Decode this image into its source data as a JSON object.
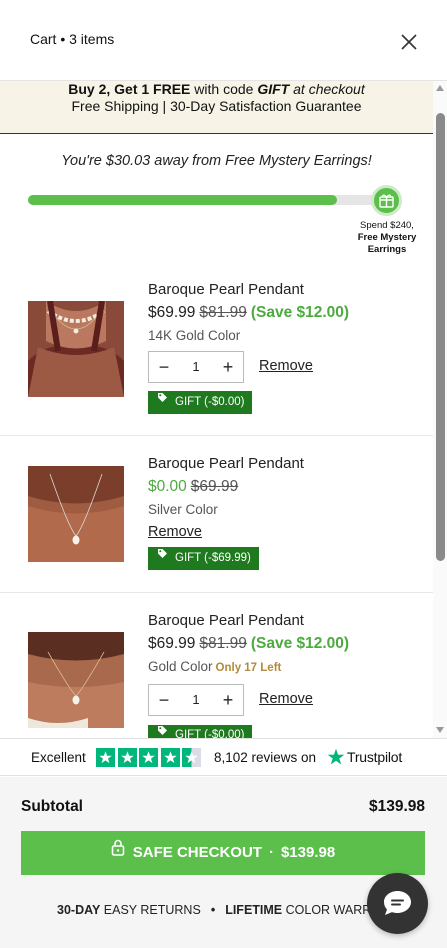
{
  "header": {
    "title": "Cart • 3 items"
  },
  "promo": {
    "line1_bold": "Buy 2, Get 1 FREE",
    "line1_mid": " with code ",
    "line1_code": "GIFT",
    "line1_end": " at checkout",
    "line2": "Free Shipping | 30-Day Satisfaction Guarantee"
  },
  "progress": {
    "message": "You're $30.03 away from Free Mystery Earrings!",
    "fraction": 0.87,
    "goal_line1": "Spend $240,",
    "goal_line2": "Free Mystery Earrings"
  },
  "items": [
    {
      "name": "Baroque Pearl Pendant",
      "price": "$69.99",
      "compare_price": "$81.99",
      "save": "(Save $12.00)",
      "variant": "14K Gold Color",
      "low_stock": "",
      "quantity": "1",
      "remove": "Remove",
      "gift": "GIFT (-$0.00)"
    },
    {
      "name": "Baroque Pearl Pendant",
      "price": "$0.00",
      "compare_price": "$69.99",
      "save": "",
      "variant": "Silver Color",
      "low_stock": "",
      "quantity": "",
      "remove": "Remove",
      "gift": "GIFT (-$69.99)"
    },
    {
      "name": "Baroque Pearl Pendant",
      "price": "$69.99",
      "compare_price": "$81.99",
      "save": "(Save $12.00)",
      "variant": "Gold Color",
      "low_stock": "Only 17 Left",
      "quantity": "1",
      "remove": "Remove",
      "gift": "GIFT (-$0.00)"
    }
  ],
  "trust": {
    "rating_word": "Excellent",
    "rating_stars": 4.5,
    "reviews": "8,102 reviews on",
    "brand": "Trustpilot"
  },
  "footer": {
    "subtotal_label": "Subtotal",
    "subtotal_value": "$139.98",
    "checkout_label": "SAFE CHECKOUT",
    "checkout_dot": "·",
    "checkout_total": "$139.98",
    "guarantee1_bold": "30-DAY",
    "guarantee1_rest": " EASY RETURNS",
    "separator": "•",
    "guarantee2_bold": "LIFETIME",
    "guarantee2_rest": " COLOR WARRANTY"
  },
  "colors": {
    "accent_green": "#5cbf4b",
    "gift_green": "#1f7a1f",
    "trustpilot_green": "#00b67a",
    "promo_bg": "#f7f4e7"
  },
  "icons": {
    "close": "close-icon",
    "gift_goal": "gift-icon",
    "tag": "tag-icon",
    "lock": "lock-icon",
    "chat": "chat-icon",
    "star": "star-icon"
  }
}
